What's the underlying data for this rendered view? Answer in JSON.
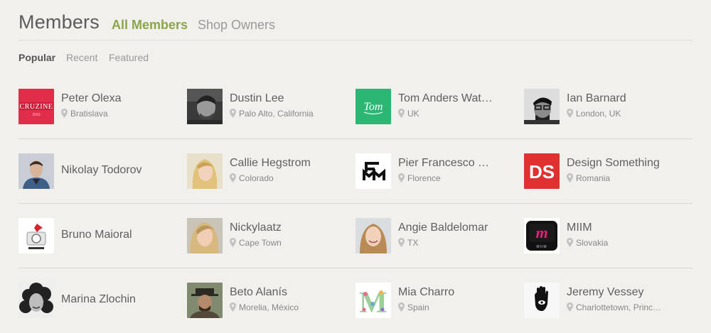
{
  "header": {
    "title": "Members",
    "tabs": [
      {
        "label": "All Members",
        "active": true
      },
      {
        "label": "Shop Owners",
        "active": false
      }
    ]
  },
  "filters": [
    {
      "label": "Popular",
      "active": true
    },
    {
      "label": "Recent",
      "active": false
    },
    {
      "label": "Featured",
      "active": false
    }
  ],
  "colors": {
    "accent_green": "#8aa647",
    "background": "#f2f0ec"
  },
  "members": [
    [
      {
        "name": "Peter Olexa",
        "location": "Bratislava",
        "avatar": "cruzine-logo"
      },
      {
        "name": "Dustin Lee",
        "location": "Palo Alto, California",
        "avatar": "photo-bw-man"
      },
      {
        "name": "Tom Anders Wat…",
        "location": "UK",
        "avatar": "tom-green-logo"
      },
      {
        "name": "Ian Barnard",
        "location": "London, UK",
        "avatar": "photo-glasses-man"
      }
    ],
    [
      {
        "name": "Nikolay Todorov",
        "location": "",
        "avatar": "photo-young-man"
      },
      {
        "name": "Callie Hegstrom",
        "location": "Colorado",
        "avatar": "photo-blonde-woman"
      },
      {
        "name": "Pier Francesco …",
        "location": "Florence",
        "avatar": "fm-monogram"
      },
      {
        "name": "Design Something",
        "location": "Romania",
        "avatar": "ds-logo"
      }
    ],
    [
      {
        "name": "Bruno Maioral",
        "location": "",
        "avatar": "camera-bird-logo"
      },
      {
        "name": "Nickylaatz",
        "location": "Cape Town",
        "avatar": "photo-blonde-woman-2"
      },
      {
        "name": "Angie Baldelomar",
        "location": "TX",
        "avatar": "photo-smiling-woman"
      },
      {
        "name": "MIIM",
        "location": "Slovakia",
        "avatar": "miim-app-icon"
      }
    ],
    [
      {
        "name": "Marina Zlochin",
        "location": "",
        "avatar": "photo-curly-woman"
      },
      {
        "name": "Beto Alanís",
        "location": "Morelia, México",
        "avatar": "photo-hat-man"
      },
      {
        "name": "Mia Charro",
        "location": "Spain",
        "avatar": "floral-m-letter"
      },
      {
        "name": "Jeremy Vessey",
        "location": "Charlottetown, Princ…",
        "avatar": "hamsa-hand"
      }
    ]
  ],
  "avatar_text": {
    "cruzine": "CRUZINE",
    "tom": "Tom",
    "ds": "DS",
    "miim_letter": "m",
    "miim_label": "MIIM",
    "floral_letter": "M"
  }
}
